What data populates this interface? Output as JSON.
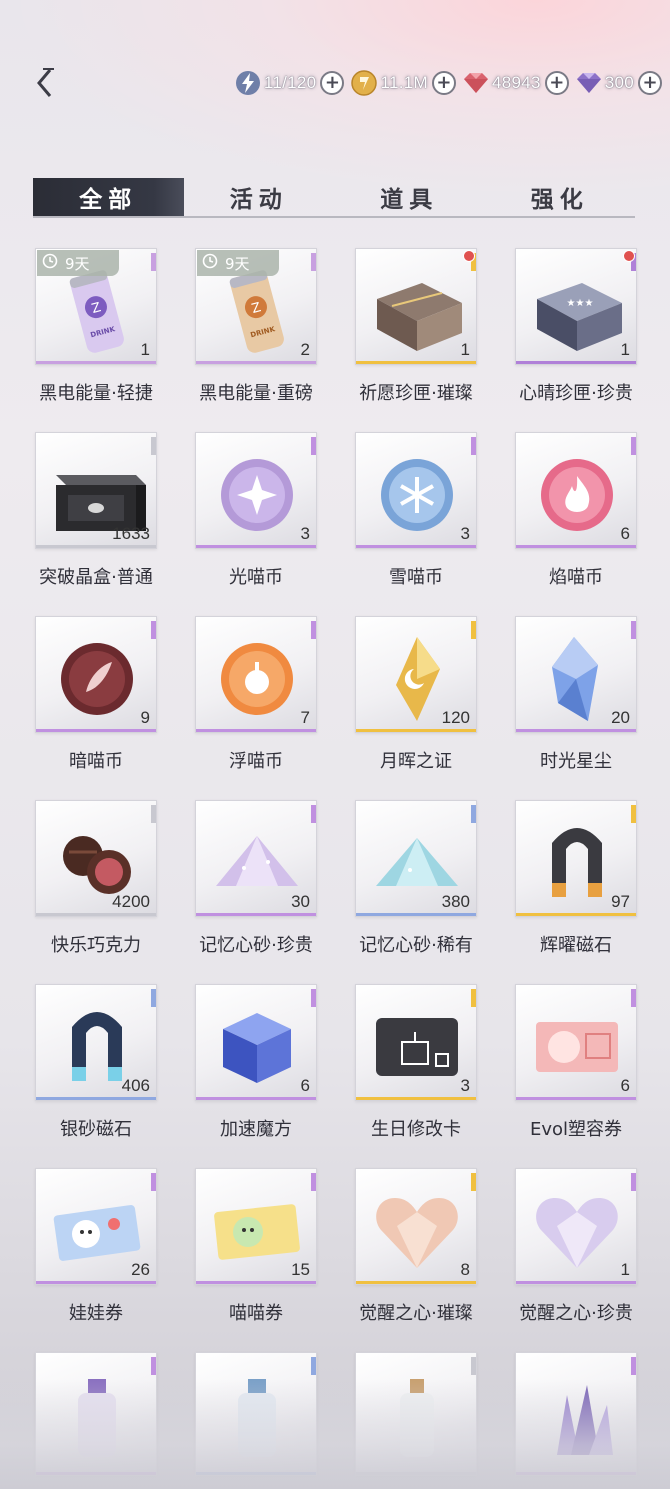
{
  "tabs": [
    {
      "label": "全部",
      "active": true
    },
    {
      "label": "活动",
      "active": false
    },
    {
      "label": "道具",
      "active": false
    },
    {
      "label": "强化",
      "active": false
    }
  ],
  "resources": {
    "stamina": {
      "value": "11/120",
      "icon": "lightning-icon"
    },
    "gold": {
      "value": "11.1M",
      "icon": "gold-coin-icon"
    },
    "crystal": {
      "value": "48943",
      "icon": "red-diamond-icon"
    },
    "gem": {
      "value": "300",
      "icon": "purple-diamond-icon"
    },
    "plus": "+"
  },
  "items": [
    {
      "name": "黑电能量·轻捷",
      "qty": "1",
      "timer": "9天",
      "rarity": "#c8a0e0",
      "art": "can-purple"
    },
    {
      "name": "黑电能量·重磅",
      "qty": "2",
      "timer": "9天",
      "rarity": "#c8a0e0",
      "art": "can-gold"
    },
    {
      "name": "祈愿珍匣·璀璨",
      "qty": "1",
      "reddot": true,
      "rarity": "#f0c040",
      "art": "chest-gold"
    },
    {
      "name": "心晴珍匣·珍贵",
      "qty": "1",
      "reddot": true,
      "rarity": "#b080d8",
      "art": "chest-purple"
    },
    {
      "name": "突破晶盒·普通",
      "qty": "1633",
      "rarity": "#c8c8d0",
      "art": "box-black"
    },
    {
      "name": "光喵币",
      "qty": "3",
      "rarity": "#c090e0",
      "art": "coin-purple"
    },
    {
      "name": "雪喵币",
      "qty": "3",
      "rarity": "#c090e0",
      "art": "coin-blue"
    },
    {
      "name": "焰喵币",
      "qty": "6",
      "rarity": "#c090e0",
      "art": "coin-pink"
    },
    {
      "name": "暗喵币",
      "qty": "9",
      "rarity": "#c090e0",
      "art": "coin-dark"
    },
    {
      "name": "浮喵币",
      "qty": "7",
      "rarity": "#c090e0",
      "art": "coin-orange"
    },
    {
      "name": "月晖之证",
      "qty": "120",
      "rarity": "#f0c040",
      "art": "crystal-gold"
    },
    {
      "name": "时光星尘",
      "qty": "20",
      "rarity": "#c090e0",
      "art": "crystal-blue"
    },
    {
      "name": "快乐巧克力",
      "qty": "4200",
      "rarity": "#c8c8d0",
      "art": "chocolate"
    },
    {
      "name": "记忆心砂·珍贵",
      "qty": "30",
      "rarity": "#c090e0",
      "art": "sand-purple"
    },
    {
      "name": "记忆心砂·稀有",
      "qty": "380",
      "rarity": "#8fa8e0",
      "art": "sand-cyan"
    },
    {
      "name": "辉曜磁石",
      "qty": "97",
      "rarity": "#f0c040",
      "art": "magnet-gold"
    },
    {
      "name": "银砂磁石",
      "qty": "406",
      "rarity": "#8fa8e0",
      "art": "magnet-blue"
    },
    {
      "name": "加速魔方",
      "qty": "6",
      "rarity": "#c090e0",
      "art": "cube"
    },
    {
      "name": "生日修改卡",
      "qty": "3",
      "rarity": "#f0c040",
      "art": "card-birthday"
    },
    {
      "name": "Evol塑容券",
      "qty": "6",
      "rarity": "#c090e0",
      "art": "ticket-pink"
    },
    {
      "name": "娃娃券",
      "qty": "26",
      "rarity": "#c090e0",
      "art": "ticket-doll"
    },
    {
      "name": "喵喵券",
      "qty": "15",
      "rarity": "#c090e0",
      "art": "ticket-cat"
    },
    {
      "name": "觉醒之心·璀璨",
      "qty": "8",
      "rarity": "#f0c040",
      "art": "heart-gold"
    },
    {
      "name": "觉醒之心·珍贵",
      "qty": "1",
      "rarity": "#c090e0",
      "art": "heart-purple"
    },
    {
      "name": "",
      "qty": "",
      "rarity": "#c090e0",
      "art": "bottle-purple"
    },
    {
      "name": "",
      "qty": "",
      "rarity": "#8fa8e0",
      "art": "bottle-blue"
    },
    {
      "name": "",
      "qty": "",
      "rarity": "#c8c8d0",
      "art": "bottle-cork"
    },
    {
      "name": "",
      "qty": "",
      "rarity": "#c090e0",
      "art": "crystal-cluster"
    }
  ]
}
